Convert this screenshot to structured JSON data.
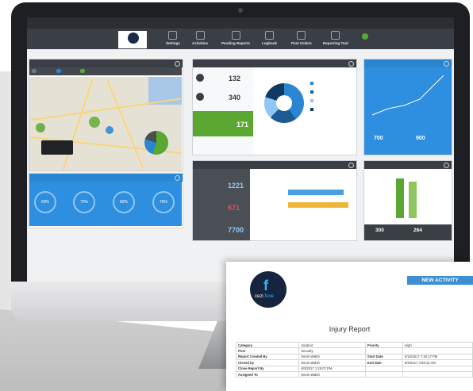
{
  "app": {
    "topbar_left": "",
    "topbar_right": ""
  },
  "nav": {
    "items": [
      {
        "label": "Settings"
      },
      {
        "label": "Activities"
      },
      {
        "label": "Pending Reports"
      },
      {
        "label": "Logbook"
      },
      {
        "label": "Post Orders"
      },
      {
        "label": "Reporting Tool"
      }
    ]
  },
  "dashboard": {
    "kpis": {
      "value_1": "132",
      "value_2": "340",
      "value_3": "171"
    },
    "reports": {
      "values": [
        "1221",
        "671",
        "7700"
      ]
    },
    "dials": {
      "values": [
        "60%",
        "70%",
        "80%",
        "76%"
      ]
    },
    "bars": {
      "values": [
        300.0,
        264.0
      ]
    },
    "line_panel": {
      "values": [
        "700",
        "900"
      ]
    }
  },
  "report": {
    "new_activity_label": "NEW ACTIVITY",
    "logo_text_1": "cezi",
    "logo_text_2": "fone",
    "title": "Injury Report",
    "rows": [
      {
        "l1": "Category",
        "v1": "Incident",
        "l2": "Priority",
        "v2": "High"
      },
      {
        "l1": "Post",
        "v1": "Security",
        "l2": "",
        "v2": ""
      },
      {
        "l1": "Report Created By",
        "v1": "Devin Walsh",
        "l2": "Start Date",
        "v2": "6/10/2017 7:30:17 PM"
      },
      {
        "l1": "Closed by",
        "v1": "Devin Walsh",
        "l2": "End date",
        "v2": "6/3/2017 4:59:13 AM"
      },
      {
        "l1": "Close Report By",
        "v1": "6/3/2017 1:25:07 PM",
        "l2": "",
        "v2": ""
      },
      {
        "l1": "Assigned To",
        "v1": "Devin Walsh",
        "l2": "",
        "v2": ""
      }
    ]
  },
  "colors": {
    "accent_blue": "#2a86d1",
    "nav_dark": "#3a3f46",
    "green": "#5aa832"
  }
}
